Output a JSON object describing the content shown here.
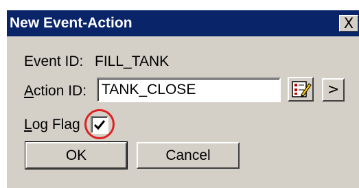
{
  "dialog": {
    "title": "New Event-Action",
    "close_label": "X"
  },
  "event": {
    "label": "Event ID:",
    "value": "FILL_TANK"
  },
  "action": {
    "label_underlined": "A",
    "label_rest": "ction ID:",
    "value": "TANK_CLOSE",
    "browse_icon": "edit-list-icon",
    "more_label": ">"
  },
  "log_flag": {
    "label_underlined": "L",
    "label_rest": "og Flag",
    "checked": true
  },
  "buttons": {
    "ok": "OK",
    "cancel": "Cancel"
  },
  "colors": {
    "titlebar": "#0a246a",
    "dialog_bg": "#d4d0c8",
    "highlight_circle": "#e02020"
  }
}
